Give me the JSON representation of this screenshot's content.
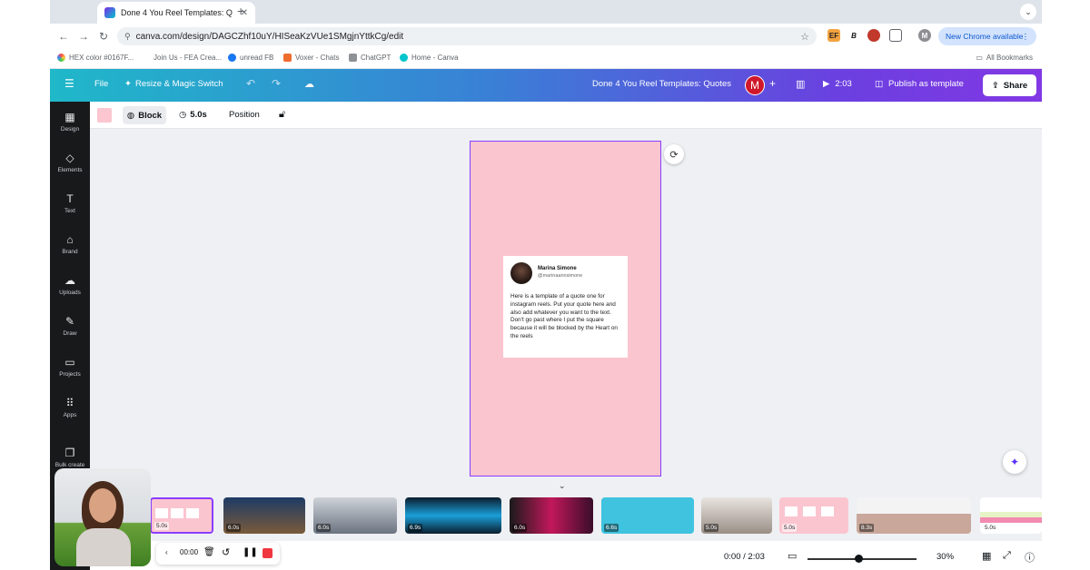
{
  "browser": {
    "tab_title": "Done 4 You Reel Templates: Q",
    "tab_close": "✕",
    "new_tab": "+",
    "url": "canva.com/design/DAGCZhf10uY/HISeaKzVUe1SMgjnYttkCg/edit",
    "update_label": "New Chrome available",
    "bookmarks": [
      "HEX color #0167F...",
      "Join Us - FEA Crea...",
      "unread FB",
      "Voxer - Chats",
      "ChatGPT",
      "Home - Canva"
    ],
    "all_bookmarks": "All Bookmarks",
    "ext_labels": [
      "EF",
      "B"
    ],
    "profile_initial": "M"
  },
  "canva": {
    "menu_file": "File",
    "resize": "Resize & Magic Switch",
    "title": "Done 4 You Reel Templates: Quotes",
    "avatar_initial": "M",
    "add": "+",
    "play_time": "2:03",
    "publish": "Publish as template",
    "share": "Share"
  },
  "sidebar": {
    "items": [
      {
        "label": "Design",
        "icon": "▦"
      },
      {
        "label": "Elements",
        "icon": "◇"
      },
      {
        "label": "Text",
        "icon": "T"
      },
      {
        "label": "Brand",
        "icon": "⌂"
      },
      {
        "label": "Uploads",
        "icon": "☁"
      },
      {
        "label": "Draw",
        "icon": "✎"
      },
      {
        "label": "Projects",
        "icon": "▭"
      },
      {
        "label": "Apps",
        "icon": "⠿"
      },
      {
        "label": "Bulk create",
        "icon": "❐"
      }
    ]
  },
  "context_toolbar": {
    "block": "Block",
    "duration": "5.0s",
    "position": "Position"
  },
  "quote_card": {
    "name": "Marina Simone",
    "handle": "@marinaannsimone",
    "text": "Here is a template of a quote one for instagram reels. Put your quote here and also add whatever you want to the text. Don't go past where I put the square because it will be blocked by the Heart on the reels"
  },
  "timeline": {
    "clips": [
      {
        "duration": "5.0s",
        "color": "#fbc5d0"
      },
      {
        "duration": "6.0s",
        "color": "#1d3b66"
      },
      {
        "duration": "6.0s",
        "color": "#7d8694"
      },
      {
        "duration": "6.9s",
        "color": "#1a9fd8"
      },
      {
        "duration": "6.0s",
        "color": "#c2185b"
      },
      {
        "duration": "6.6s",
        "color": "#3fc3df"
      },
      {
        "duration": "5.0s",
        "color": "#9a8f86"
      },
      {
        "duration": "5.0s",
        "color": "#fbc5d0"
      },
      {
        "duration": "8.3s",
        "color": "#c9a89b"
      },
      {
        "duration": "5.0s",
        "color": "#e6f3c6"
      }
    ]
  },
  "bottom": {
    "time": "0:00 / 2:03",
    "zoom": "30%",
    "zoom_level": 0.3
  },
  "recorder": {
    "time": "00:00"
  },
  "colors": {
    "accent": "#8b3dff",
    "page_bg": "#fbc5d0",
    "header_start": "#1fb8c9",
    "header_end": "#8238e4"
  }
}
